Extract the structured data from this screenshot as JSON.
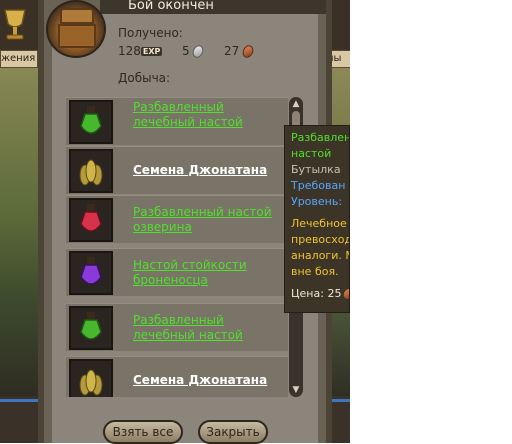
{
  "dialog": {
    "title": "Бой окончен",
    "received_label": "Получено:",
    "loot_label": "Добыча:"
  },
  "rewards": {
    "exp_value": "128",
    "exp_badge": "EXP",
    "silver_value": "5",
    "bronze_value": "27"
  },
  "loot_items": [
    {
      "name": "Разбавленный лечебный настой",
      "color": "green",
      "icon": "green-potion-icon"
    },
    {
      "name": "Семена Джонатана",
      "color": "white",
      "icon": "seeds-icon"
    },
    {
      "name": "Разбавленный настой озверина",
      "color": "green",
      "icon": "red-potion-icon"
    },
    {
      "name": "Настой стойкости броненосца",
      "color": "green",
      "icon": "purple-potion-icon"
    },
    {
      "name": "Разбавленный лечебный настой",
      "color": "green",
      "icon": "green-potion-icon"
    },
    {
      "name": "Семена Джонатана",
      "color": "white",
      "icon": "seeds-icon"
    }
  ],
  "buttons": {
    "take_all": "Взять все",
    "close": "Закрыть"
  },
  "side_tabs": {
    "left": "жения",
    "right": "ны"
  },
  "tooltip": {
    "lines": [
      {
        "text": "Разбавлен",
        "style": "green"
      },
      {
        "text": "настой",
        "style": "green"
      },
      {
        "text": "Бутылка",
        "style": "gray"
      },
      {
        "text": "Требован",
        "style": "blue"
      },
      {
        "text": "Уровень:",
        "style": "blue"
      },
      {
        "text": "Лечебное",
        "style": "yellow"
      },
      {
        "text": "превосход",
        "style": "yellow"
      },
      {
        "text": "аналоги. М",
        "style": "yellow"
      },
      {
        "text": "вне боя.",
        "style": "yellow"
      }
    ],
    "price_label": "Цена: 25"
  },
  "colors": {
    "accent_green": "#4fe02c",
    "frame": "#4b4336",
    "panel": "#8c857b"
  }
}
